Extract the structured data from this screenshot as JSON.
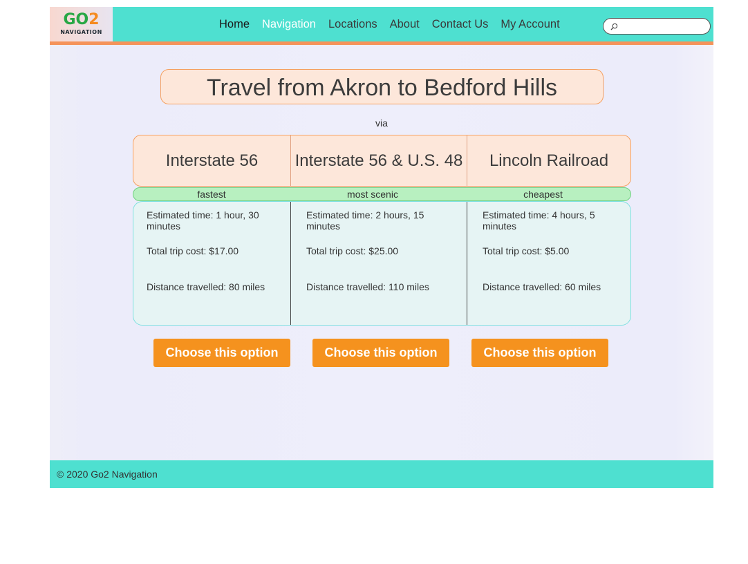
{
  "header": {
    "logo": {
      "main_a": "GO",
      "main_b": "2",
      "sub": "NAVIGATION"
    },
    "nav": [
      {
        "label": "Home"
      },
      {
        "label": "Navigation"
      },
      {
        "label": "Locations"
      },
      {
        "label": "About"
      },
      {
        "label": "Contact Us"
      },
      {
        "label": "My Account"
      }
    ],
    "search": {
      "value": "",
      "placeholder": ""
    }
  },
  "main": {
    "title": "Travel from Akron to Bedford Hills",
    "via": "via",
    "routes": [
      {
        "name": "Interstate 56",
        "tag": "fastest",
        "time": "Estimated time: 1 hour, 30 minutes",
        "cost": "Total trip cost: $17.00",
        "distance": "Distance travelled: 80 miles",
        "button": "Choose this option"
      },
      {
        "name": "Interstate 56 & U.S. 48",
        "tag": "most scenic",
        "time": "Estimated time: 2 hours, 15 minutes",
        "cost": "Total trip cost: $25.00",
        "distance": "Distance travelled: 110 miles",
        "button": "Choose this option"
      },
      {
        "name": "Lincoln Railroad",
        "tag": "cheapest",
        "time": "Estimated time: 4 hours, 5 minutes",
        "cost": "Total trip cost: $5.00",
        "distance": "Distance travelled: 60 miles",
        "button": "Choose this option"
      }
    ]
  },
  "footer": {
    "copyright": "© 2020 Go2 Navigation"
  },
  "colors": {
    "header_bg": "#4ee0d0",
    "accent_orange": "#f5921e",
    "title_bg": "#fde7da",
    "tag_bg": "#b8f0c0",
    "details_bg": "#e6f4f4"
  },
  "icons": {
    "search": "search-icon"
  }
}
